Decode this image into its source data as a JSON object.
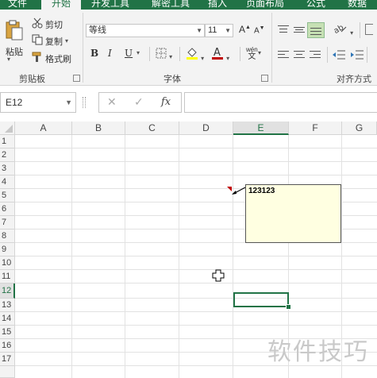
{
  "ribbon_tabs": [
    "文件",
    "开始",
    "开发工具",
    "解密工具",
    "插入",
    "页面布局",
    "公式",
    "数据"
  ],
  "active_tab": "开始",
  "clipboard": {
    "paste_label": "粘贴",
    "cut_label": "剪切",
    "copy_label": "复制",
    "format_painter_label": "格式刷",
    "group_label": "剪贴板"
  },
  "font": {
    "font_name": "等线",
    "font_size": "11",
    "bold": "B",
    "italic": "I",
    "underline": "U",
    "wen": "wén",
    "grow": "A",
    "shrink": "A",
    "group_label": "字体",
    "font_color_hex": "#c00000",
    "fill_color_hex": "#ffff00"
  },
  "alignment": {
    "group_label": "对齐方式"
  },
  "formula_bar": {
    "name_box": "E12",
    "fx": "fx",
    "value": ""
  },
  "grid": {
    "columns": [
      "A",
      "B",
      "C",
      "D",
      "E",
      "F",
      "G"
    ],
    "selected_column": "E",
    "rows": [
      "1",
      "2",
      "3",
      "4",
      "5",
      "6",
      "7",
      "8",
      "9",
      "10",
      "11",
      "12",
      "13",
      "14",
      "15",
      "16",
      "17"
    ],
    "selected_row": "12",
    "active_cell": "E12"
  },
  "comment": {
    "text": "123123"
  },
  "watermark": "软件技巧",
  "colors": {
    "excel_green": "#217346",
    "comment_bg": "#ffffe1",
    "comment_indicator": "#c00000"
  }
}
